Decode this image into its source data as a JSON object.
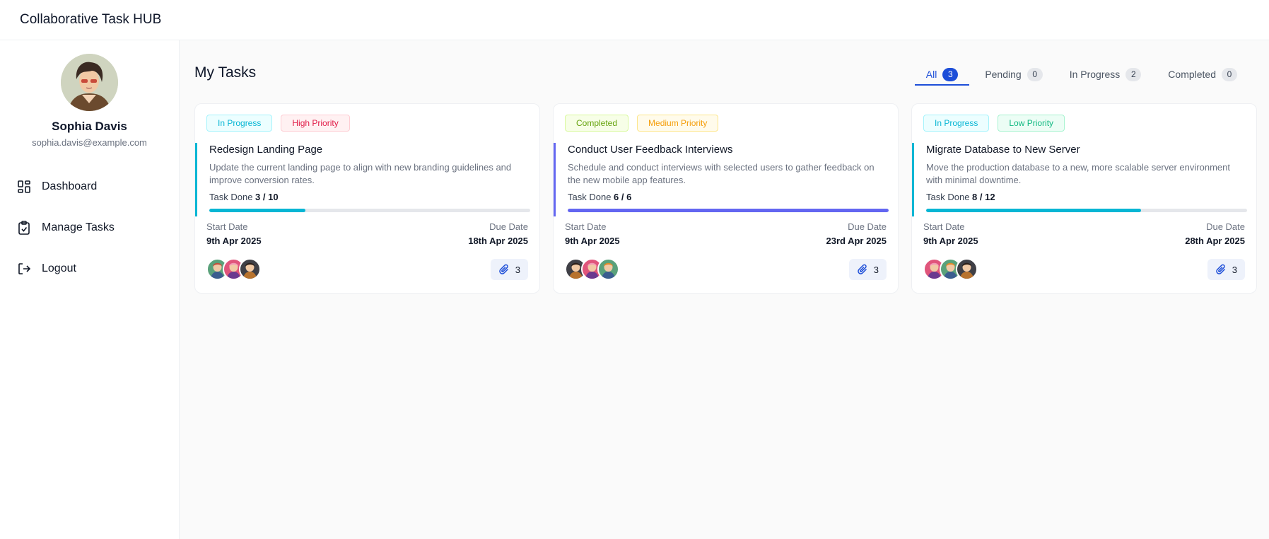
{
  "app": {
    "title": "Collaborative Task HUB"
  },
  "user": {
    "name": "Sophia Davis",
    "email": "sophia.davis@example.com"
  },
  "nav": [
    {
      "label": "Dashboard",
      "icon": "dashboard-icon"
    },
    {
      "label": "Manage Tasks",
      "icon": "clipboard-check-icon"
    },
    {
      "label": "Logout",
      "icon": "logout-icon"
    }
  ],
  "page": {
    "title": "My Tasks"
  },
  "tabs": [
    {
      "label": "All",
      "count": "3",
      "active": true
    },
    {
      "label": "Pending",
      "count": "0"
    },
    {
      "label": "In Progress",
      "count": "2"
    },
    {
      "label": "Completed",
      "count": "0"
    }
  ],
  "labels": {
    "task_done": "Task Done",
    "start_date": "Start Date",
    "due_date": "Due Date"
  },
  "colors": {
    "accent": "#1d4ed8",
    "in_progress": "#06b6d4",
    "completed": "#6366f1"
  },
  "tasks": [
    {
      "status": "In Progress",
      "priority": "High Priority",
      "title": "Redesign Landing Page",
      "description": "Update the current landing page to align with new branding guidelines and improve conversion rates.",
      "done": "3 / 10",
      "progress": 0.3,
      "start": "9th Apr 2025",
      "due": "18th Apr 2025",
      "attachments": "3"
    },
    {
      "status": "Completed",
      "priority": "Medium Priority",
      "title": "Conduct User Feedback Interviews",
      "description": "Schedule and conduct interviews with selected users to gather feedback on the new mobile app features.",
      "done": "6 / 6",
      "progress": 1.0,
      "start": "9th Apr 2025",
      "due": "23rd Apr 2025",
      "attachments": "3"
    },
    {
      "status": "In Progress",
      "priority": "Low Priority",
      "title": "Migrate Database to New Server",
      "description": "Move the production database to a new, more scalable server environment with minimal downtime.",
      "done": "8 / 12",
      "progress": 0.67,
      "start": "9th Apr 2025",
      "due": "28th Apr 2025",
      "attachments": "3"
    }
  ]
}
